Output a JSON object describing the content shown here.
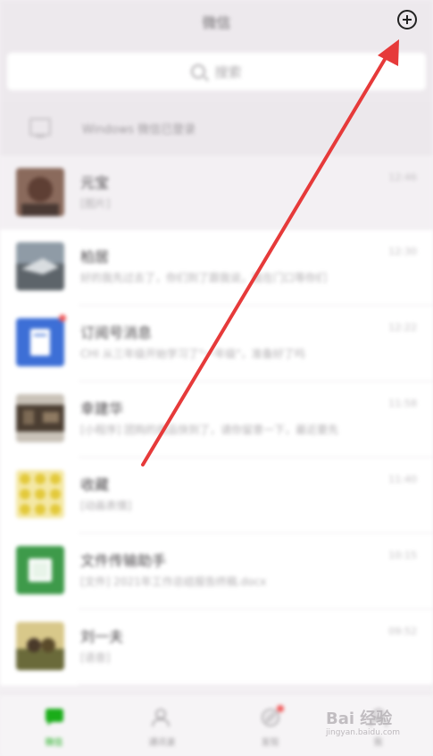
{
  "header": {
    "title": "微信",
    "add_icon": "plus-circle-icon"
  },
  "search": {
    "label": "搜索"
  },
  "windows_notice": {
    "text": "Windows 微信已登录"
  },
  "chats": [
    {
      "name": "元宝",
      "preview": "[图片]",
      "time": "12:46",
      "pinned": true,
      "badge": false,
      "avatar_color": "#6b5046"
    },
    {
      "name": "柏居",
      "preview": "好的我先过去了，你们到了跟我说，我在门口等你们",
      "time": "12:30",
      "pinned": false,
      "badge": false,
      "avatar_color": "#7d8590"
    },
    {
      "name": "订阅号消息",
      "preview": "CHI 从三年级开始学习了\"一年级\"，准备好了吗",
      "time": "12:22",
      "pinned": false,
      "badge": true,
      "avatar_color": "#3d6fd6"
    },
    {
      "name": "幸建华",
      "preview": "[小程序] 团购的商品快到了，请你留意一下，最近要先",
      "time": "11:58",
      "pinned": false,
      "badge": false,
      "avatar_color": "#5a4a3c"
    },
    {
      "name": "收藏",
      "preview": "[动画表情]",
      "time": "11:40",
      "pinned": false,
      "badge": false,
      "avatar_color": "#e8d64a"
    },
    {
      "name": "文件传输助手",
      "preview": "[文件] 2021年工作总结报告终稿.docx",
      "time": "10:15",
      "pinned": false,
      "badge": false,
      "avatar_color": "#3e9a4a"
    },
    {
      "name": "刘一夫",
      "preview": "[语音]",
      "time": "09:52",
      "pinned": false,
      "badge": false,
      "avatar_color": "#8a7a3a"
    }
  ],
  "tabs": [
    {
      "label": "微信",
      "icon": "chat-bubble-icon",
      "active": true,
      "badge": false
    },
    {
      "label": "通讯录",
      "icon": "contacts-icon",
      "active": false,
      "badge": false
    },
    {
      "label": "发现",
      "icon": "compass-icon",
      "active": false,
      "badge": true
    },
    {
      "label": "我",
      "icon": "person-icon",
      "active": false,
      "badge": false
    }
  ],
  "watermark": {
    "text": "Bai 经验",
    "sub": "jingyan.baidu.com"
  },
  "colors": {
    "arrow": "#e63a3a",
    "accent_green": "#1aad19",
    "badge_red": "#f05a5a"
  }
}
